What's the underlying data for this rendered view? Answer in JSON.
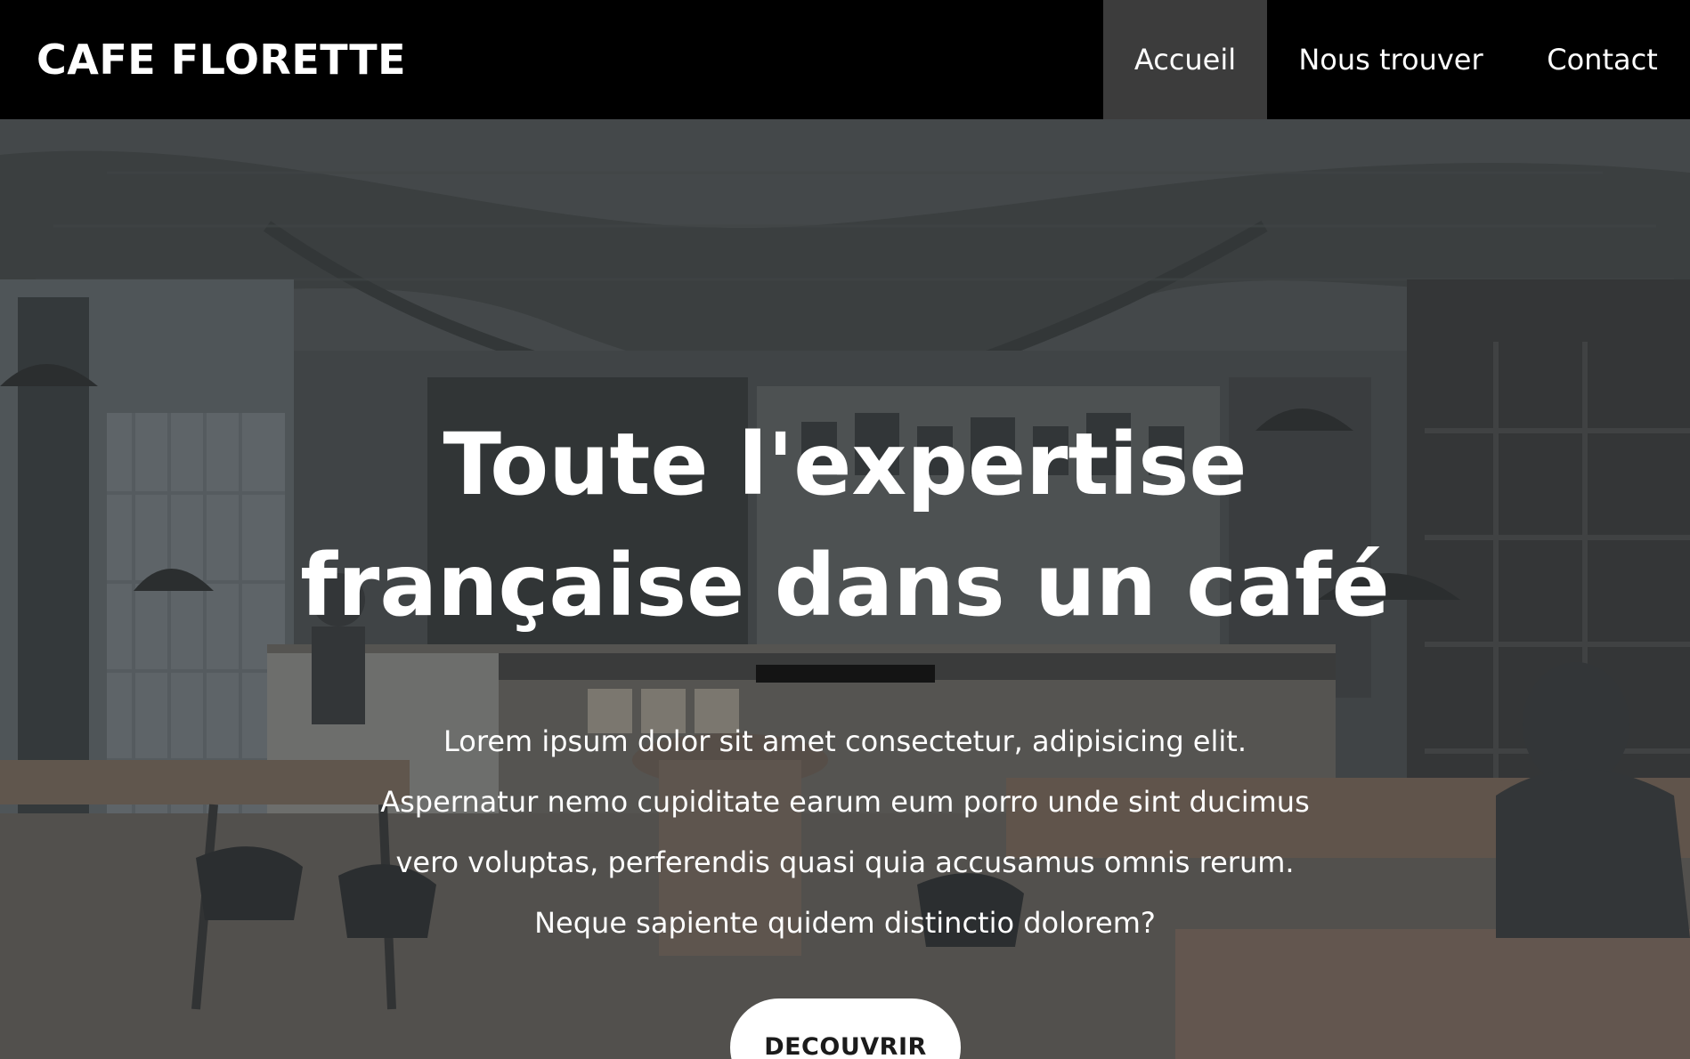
{
  "brand": {
    "name": "CAFE FLORETTE"
  },
  "nav": {
    "items": [
      {
        "label": "Accueil",
        "active": true
      },
      {
        "label": "Nous trouver",
        "active": false
      },
      {
        "label": "Contact",
        "active": false
      }
    ]
  },
  "hero": {
    "title_lines": [
      "Toute l'expertise",
      "française dans un café"
    ],
    "text_lines": [
      "Lorem ipsum dolor sit amet consectetur, adipisicing elit.",
      "Aspernatur nemo cupiditate earum eum porro unde sint ducimus",
      "vero voluptas, perferendis quasi quia accusamus omnis rerum.",
      "Neque sapiente quidem distinctio dolorem?"
    ],
    "cta_label": "DECOUVRIR",
    "background_image": "cafe-interior-photo"
  },
  "colors": {
    "navbar_bg": "#000000",
    "nav_active_bg": "#3c3c3c",
    "divider": "#141414",
    "button_bg": "#ffffff",
    "text_light": "#ffffff"
  }
}
